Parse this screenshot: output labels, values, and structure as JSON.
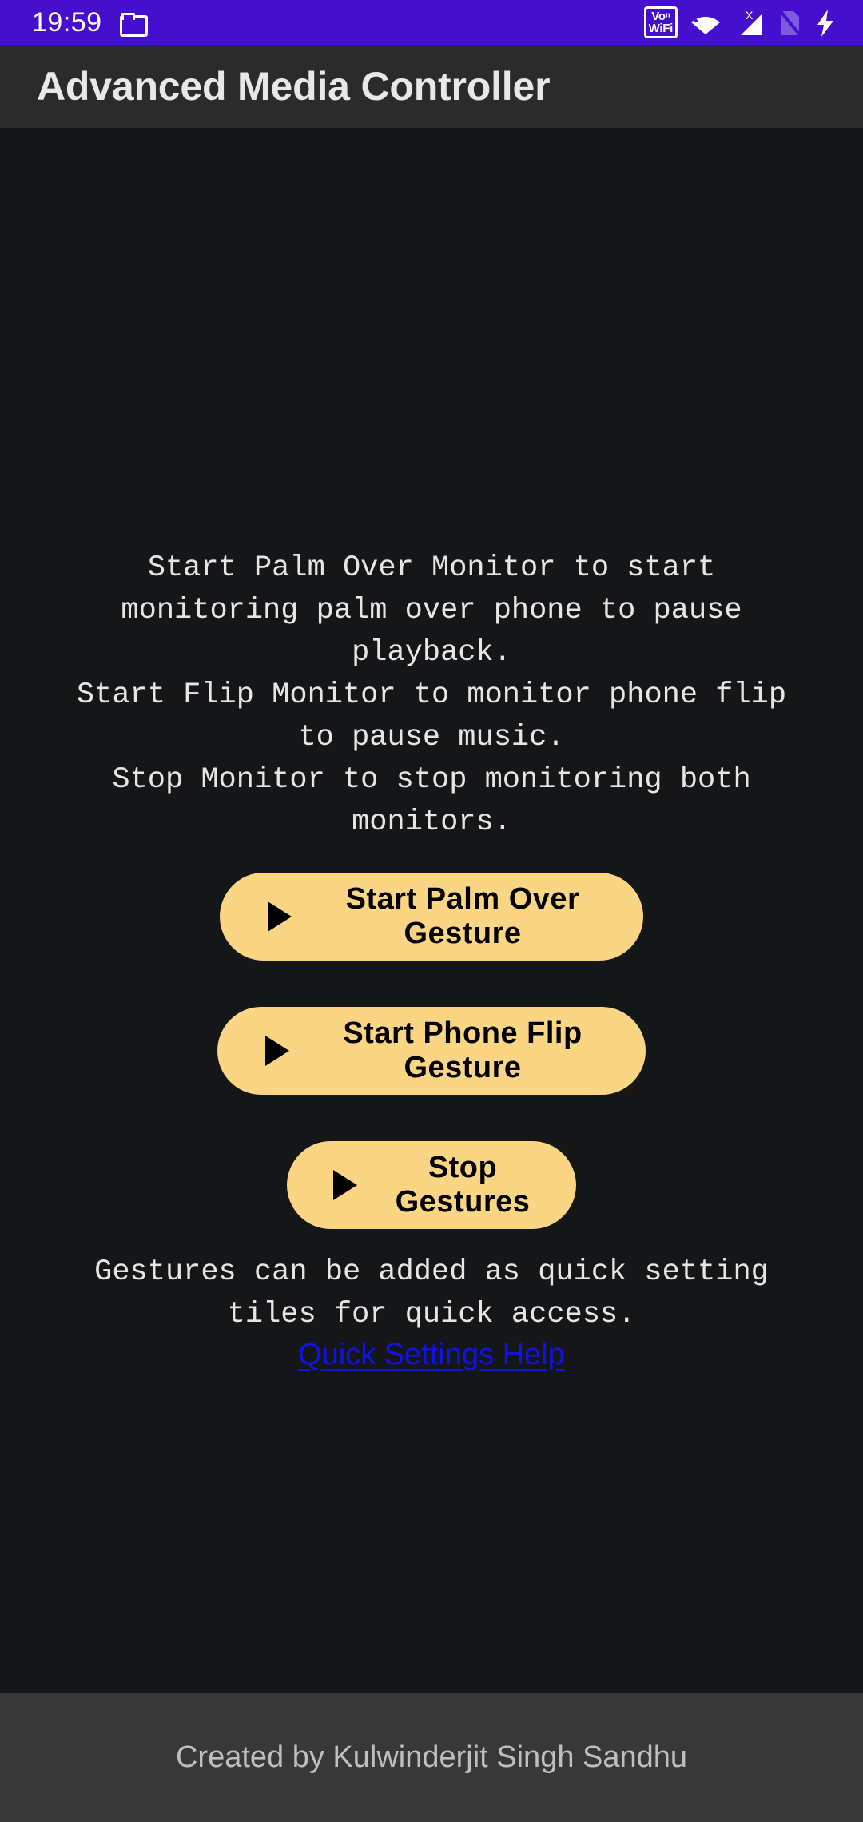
{
  "status_bar": {
    "time": "19:59",
    "background_color": "#4410CE",
    "icons": [
      {
        "name": "folder-icon",
        "label": "folder"
      },
      {
        "name": "volte-wifi-icon",
        "label_top": "Voⁿ",
        "label_bottom": "WiFi"
      },
      {
        "name": "wifi-icon",
        "label": "wifi"
      },
      {
        "name": "signal-no-service-icon",
        "label": "X"
      },
      {
        "name": "sim-card-off-icon",
        "label": "sim off"
      },
      {
        "name": "battery-charging-icon",
        "label": "charging"
      }
    ]
  },
  "app_bar": {
    "title": "Advanced Media Controller",
    "background_color": "#2B2B2B"
  },
  "main": {
    "instructions": "Start Palm Over Monitor to start\nmonitoring palm over phone to pause\nplayback.\nStart Flip Monitor to monitor phone flip\nto pause music.\nStop Monitor to stop monitoring both\nmonitors.",
    "buttons": [
      {
        "id": "palm",
        "label": "Start Palm Over Gesture",
        "icon": "play-icon",
        "color": "#FAD583"
      },
      {
        "id": "flip",
        "label": "Start Phone Flip Gesture",
        "icon": "play-icon",
        "color": "#FAD583"
      },
      {
        "id": "stop",
        "label": "Stop Gestures",
        "icon": "play-icon",
        "color": "#FAD583"
      }
    ],
    "quick_note": "Gestures can be added as quick setting\ntiles for quick access.",
    "quick_link": "Quick Settings Help",
    "link_color": "#1212E8"
  },
  "footer": {
    "text": "Created by Kulwinderjit Singh Sandhu",
    "background_color": "#383838"
  }
}
